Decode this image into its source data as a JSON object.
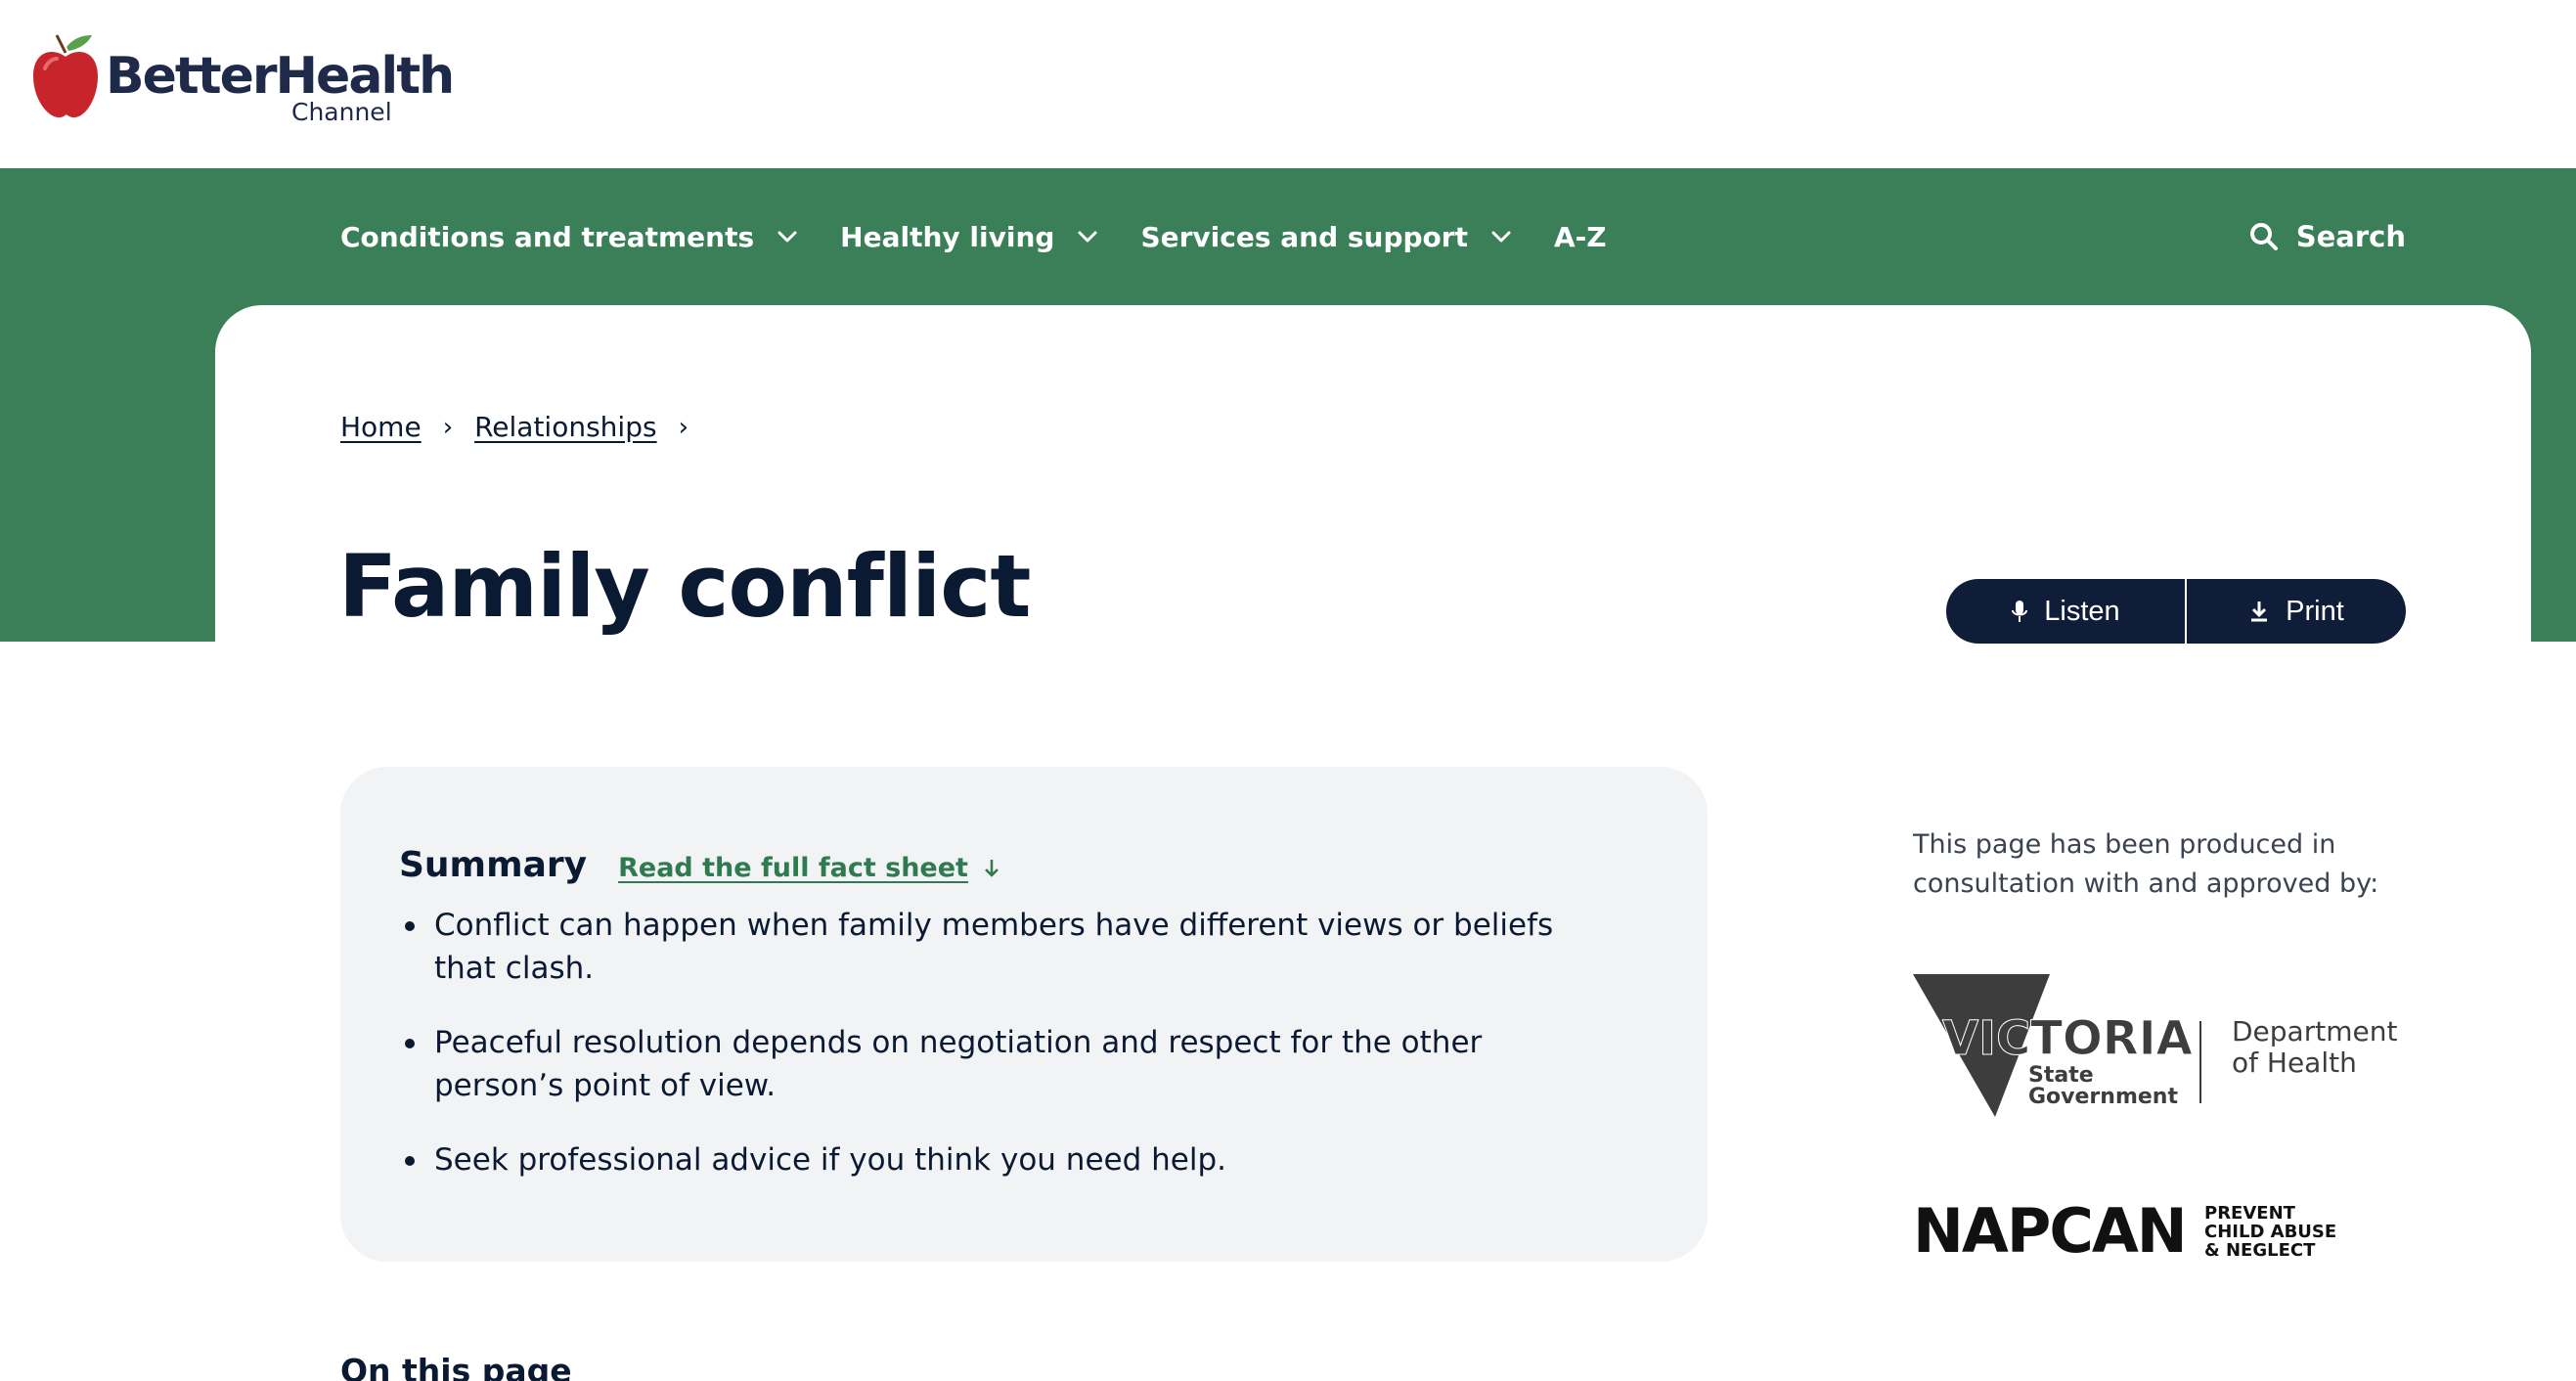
{
  "logo": {
    "main": "BetterHealth",
    "sub": "Channel"
  },
  "nav": {
    "items": [
      {
        "label": "Conditions and treatments",
        "has_dropdown": true
      },
      {
        "label": "Healthy living",
        "has_dropdown": true
      },
      {
        "label": "Services and support",
        "has_dropdown": true
      },
      {
        "label": "A-Z",
        "has_dropdown": false
      }
    ],
    "search_label": "Search"
  },
  "breadcrumb": {
    "home": "Home",
    "relationships": "Relationships",
    "separator": "›"
  },
  "page": {
    "title": "Family conflict"
  },
  "actions": {
    "listen": "Listen",
    "print": "Print"
  },
  "summary": {
    "title": "Summary",
    "link": "Read the full fact sheet",
    "items": [
      "Conflict can happen when family members have different views or beliefs that clash.",
      "Peaceful resolution depends on negotiation and respect for the other person’s point of view.",
      "Seek professional advice if you think you need help."
    ]
  },
  "sidebar": {
    "note": "This page has been produced in consultation with and approved by:",
    "vic": {
      "name": "VICTORIA",
      "state": "State",
      "government": "Government",
      "dept_line1": "Department",
      "dept_line2": "of Health"
    },
    "napcan": {
      "name": "NAPCAN",
      "line1": "PREVENT",
      "line2": "CHILD ABUSE",
      "line3": "& NEGLECT"
    }
  },
  "on_this_page": "On this page",
  "colors": {
    "brand_green": "#3a7f58",
    "navy": "#0f1d38",
    "link_green": "#2f7a4f",
    "summary_bg": "#f2f3f5"
  }
}
